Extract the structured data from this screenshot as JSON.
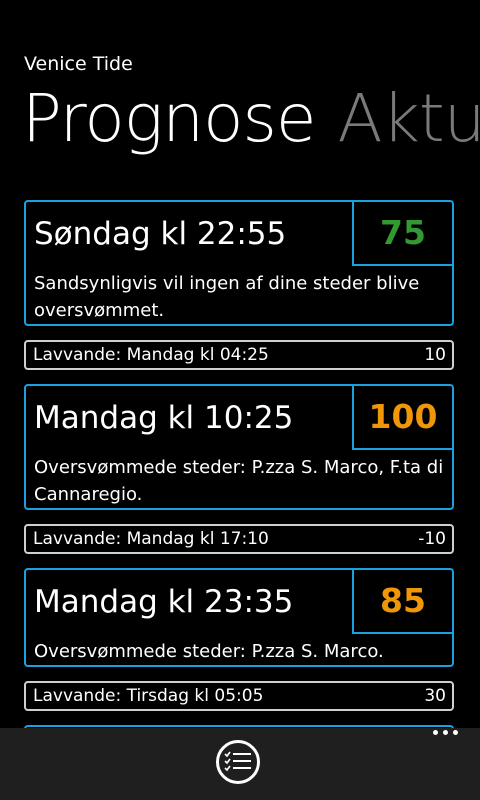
{
  "app": {
    "title": "Venice Tide"
  },
  "pivot": {
    "active": "Prognose",
    "next": "Aktu"
  },
  "forecasts": [
    {
      "time": "Søndag kl 22:55",
      "level": "75",
      "level_color": "#339933",
      "description": "Sandsynligvis vil ingen af dine steder blive oversvømmet."
    },
    {
      "time": "Mandag kl 10:25",
      "level": "100",
      "level_color": "#f09609",
      "description": "Oversvømmede steder: P.zza S. Marco, F.ta di Cannaregio."
    },
    {
      "time": "Mandag kl 23:35",
      "level": "85",
      "level_color": "#f09609",
      "description": "Oversvømmede steder: P.zza S. Marco."
    }
  ],
  "low_tides": [
    {
      "label": "Lavvande: Mandag kl 04:25",
      "value": "10"
    },
    {
      "label": "Lavvande: Mandag kl 17:10",
      "value": "-10"
    },
    {
      "label": "Lavvande: Tirsdag kl 05:05",
      "value": "30"
    }
  ],
  "colors": {
    "accent": "#1ba1e2",
    "appbar": "#1f1f1f"
  },
  "appbar": {
    "button_icon": "list-check-icon",
    "more_icon": "more-dots-icon"
  }
}
